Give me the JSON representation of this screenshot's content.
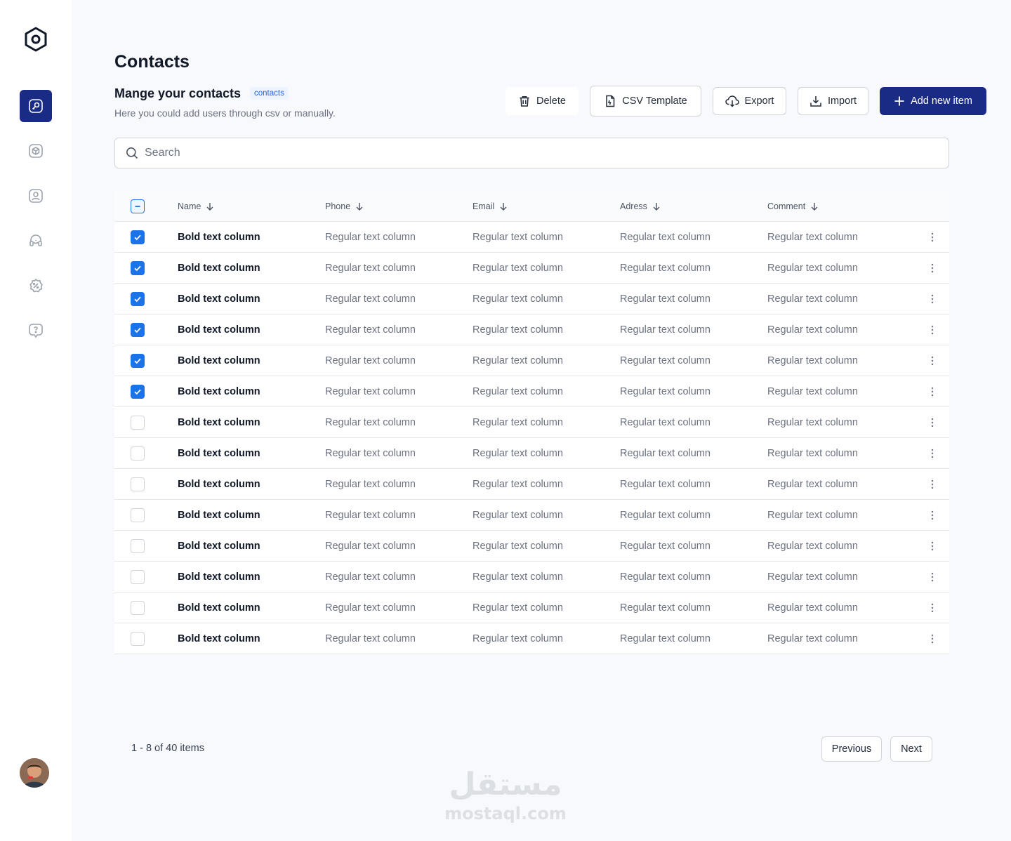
{
  "app": {
    "accent": "#1a2b86",
    "checkbox_color": "#1a73e8"
  },
  "sidebar": {
    "items": [
      {
        "icon": "key-icon",
        "active": true
      },
      {
        "icon": "box-icon",
        "active": false
      },
      {
        "icon": "user-icon",
        "active": false
      },
      {
        "icon": "headset-icon",
        "active": false
      },
      {
        "icon": "discount-badge-icon",
        "active": false
      },
      {
        "icon": "help-chat-icon",
        "active": false
      }
    ]
  },
  "header": {
    "title": "Contacts",
    "subtitle": "Mange your contacts",
    "tag": "contacts",
    "description": "Here you could add users through csv or manually."
  },
  "toolbar": {
    "delete_label": "Delete",
    "csv_label": "CSV Template",
    "export_label": "Export",
    "import_label": "Import",
    "add_label": "Add new item"
  },
  "search": {
    "placeholder": "Search"
  },
  "table": {
    "columns": [
      "Name",
      "Phone",
      "Email",
      "Adress",
      "Comment"
    ],
    "rows": [
      {
        "checked": true,
        "name": "Bold text column",
        "phone": "Regular text column",
        "email": "Regular text column",
        "address": "Regular text column",
        "comment": "Regular text column"
      },
      {
        "checked": true,
        "name": "Bold text column",
        "phone": "Regular text column",
        "email": "Regular text column",
        "address": "Regular text column",
        "comment": "Regular text column"
      },
      {
        "checked": true,
        "name": "Bold text column",
        "phone": "Regular text column",
        "email": "Regular text column",
        "address": "Regular text column",
        "comment": "Regular text column"
      },
      {
        "checked": true,
        "name": "Bold text column",
        "phone": "Regular text column",
        "email": "Regular text column",
        "address": "Regular text column",
        "comment": "Regular text column"
      },
      {
        "checked": true,
        "name": "Bold text column",
        "phone": "Regular text column",
        "email": "Regular text column",
        "address": "Regular text column",
        "comment": "Regular text column"
      },
      {
        "checked": true,
        "name": "Bold text column",
        "phone": "Regular text column",
        "email": "Regular text column",
        "address": "Regular text column",
        "comment": "Regular text column"
      },
      {
        "checked": false,
        "name": "Bold text column",
        "phone": "Regular text column",
        "email": "Regular text column",
        "address": "Regular text column",
        "comment": "Regular text column"
      },
      {
        "checked": false,
        "name": "Bold text column",
        "phone": "Regular text column",
        "email": "Regular text column",
        "address": "Regular text column",
        "comment": "Regular text column"
      },
      {
        "checked": false,
        "name": "Bold text column",
        "phone": "Regular text column",
        "email": "Regular text column",
        "address": "Regular text column",
        "comment": "Regular text column"
      },
      {
        "checked": false,
        "name": "Bold text column",
        "phone": "Regular text column",
        "email": "Regular text column",
        "address": "Regular text column",
        "comment": "Regular text column"
      },
      {
        "checked": false,
        "name": "Bold text column",
        "phone": "Regular text column",
        "email": "Regular text column",
        "address": "Regular text column",
        "comment": "Regular text column"
      },
      {
        "checked": false,
        "name": "Bold text column",
        "phone": "Regular text column",
        "email": "Regular text column",
        "address": "Regular text column",
        "comment": "Regular text column"
      },
      {
        "checked": false,
        "name": "Bold text column",
        "phone": "Regular text column",
        "email": "Regular text column",
        "address": "Regular text column",
        "comment": "Regular text column"
      },
      {
        "checked": false,
        "name": "Bold text column",
        "phone": "Regular text column",
        "email": "Regular text column",
        "address": "Regular text column",
        "comment": "Regular text column"
      }
    ]
  },
  "pagination": {
    "info": "1 - 8 of 40 items",
    "previous_label": "Previous",
    "next_label": "Next"
  },
  "watermark": {
    "arabic": "مستقل",
    "latin": "mostaql.com"
  }
}
